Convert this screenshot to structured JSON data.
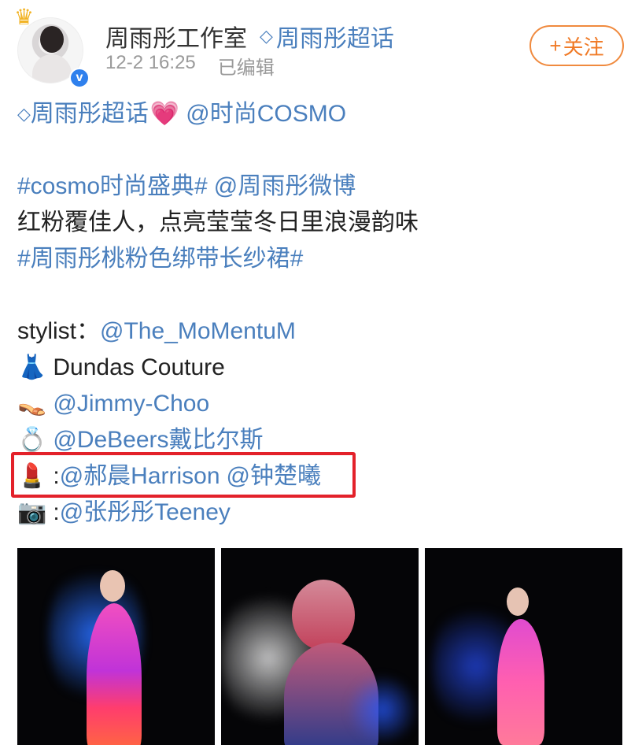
{
  "header": {
    "username": "周雨彤工作室",
    "supertopic": "周雨彤超话",
    "time": "12-2 16:25",
    "edited": "已编辑",
    "follow_label": "关注",
    "follow_plus": "+",
    "verified_mark": "v"
  },
  "post": {
    "line1": {
      "supertopic": "周雨彤超话",
      "heart": "💗",
      "mention": "@时尚COSMO"
    },
    "line3": {
      "hashtag": "#cosmo时尚盛典#",
      "mention": "@周雨彤微博"
    },
    "line4": "红粉覆佳人，点亮莹莹冬日里浪漫韵味",
    "line5": {
      "hashtag": "#周雨彤桃粉色绑带长纱裙#"
    },
    "stylist": {
      "label": "stylist：",
      "mention": "@The_MoMentuM"
    },
    "dress": {
      "emoji": "👗",
      "text": "Dundas Couture"
    },
    "shoes": {
      "emoji": "👡",
      "mention": "@Jimmy-Choo"
    },
    "ring": {
      "emoji": "💍",
      "mention": "@DeBeers戴比尔斯"
    },
    "makeup": {
      "emoji": "💄",
      "sep": ":",
      "mention1": "@郝晨Harrison",
      "mention2": "@钟楚曦"
    },
    "camera": {
      "emoji": "📷",
      "sep": ":",
      "mention": "@张彤彤Teeney"
    }
  },
  "colors": {
    "link": "#4a7fbd",
    "follow": "#f07a26",
    "highlight": "#e3212a",
    "meta": "#9a9a9a"
  },
  "icons": [
    "crown-icon",
    "verified-icon",
    "diamond-icon",
    "plus-icon"
  ]
}
